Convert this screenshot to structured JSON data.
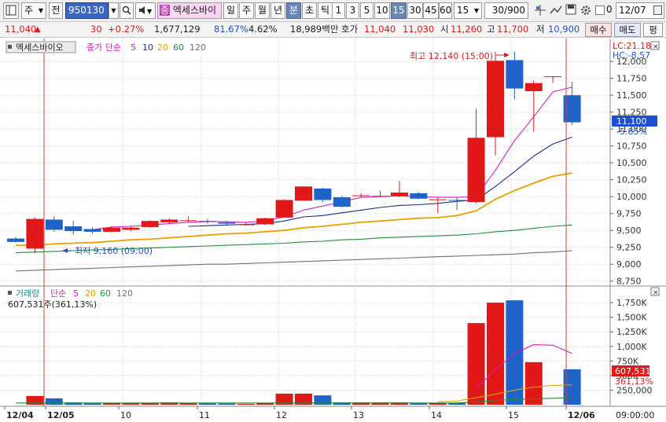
{
  "toolbar": {
    "type_label": "주",
    "all_label": "전",
    "code_value": "950130",
    "stock_tag": "종",
    "stock_name": "엑세스바이",
    "periods": [
      "일",
      "주",
      "월",
      "년",
      "분",
      "초",
      "틱"
    ],
    "selected_period": "분",
    "minutes": [
      "1",
      "3",
      "5",
      "10",
      "15",
      "30",
      "45",
      "60"
    ],
    "selected_minute": "15",
    "interval_value": "15",
    "count_value": "30/900",
    "checkbox_value": "0",
    "date_value": "12/07"
  },
  "quote": {
    "price": "11,040",
    "change": "30",
    "change_pct": "+0.27%",
    "volume": "1,677,129",
    "ratio": "81.67%",
    "ratio2": "4.62%",
    "amount": "18,989백만",
    "ask_label": "호가",
    "ask": "11,040",
    "bid": "11,030",
    "open_label": "시",
    "open": "11,260",
    "high_label": "고",
    "high": "11,700",
    "low_label": "저",
    "low": "10,900",
    "buy_label": "매수",
    "sell_label": "매도",
    "eval_label": "평"
  },
  "chart": {
    "stock_name": "엑세스바이오",
    "ma_legend": {
      "title": "종가 단순",
      "periods": [
        "5",
        "10",
        "20",
        "60",
        "120"
      ]
    },
    "lc_text": "LC:21.18",
    "hc_text": "HC:-8.57",
    "price_badge": "11,100",
    "price_change": "-5.85%",
    "high_annotation": "최고 12,140 (15:00)",
    "low_annotation": "최저 9,160 (09:00)",
    "y_ticks": [
      "12,000",
      "11,750",
      "11,500",
      "11,250",
      "11,000",
      "10,750",
      "10,500",
      "10,250",
      "10,000",
      "9,750",
      "9,500",
      "9,250",
      "9,000",
      "8,750"
    ],
    "vol_legend": {
      "title": "거래량",
      "ma_title": "단순",
      "periods": [
        "5",
        "20",
        "60",
        "120"
      ]
    },
    "vol_info": "607,531주(361,13%)",
    "vol_ticks": [
      "1,750K",
      "1,500K",
      "1,250K",
      "1,000K",
      "750K",
      "500K",
      "250,000"
    ],
    "vol_badge": "607,531",
    "vol_pct": "361,13%",
    "x_labels": [
      "12/04",
      "12/05",
      "10",
      "11",
      "12",
      "13",
      "14",
      "15",
      "12/06"
    ],
    "time_label": "09:00:00"
  },
  "colors": {
    "up": "#e01818",
    "down": "#1f62c8",
    "ma5": "#d51ccb",
    "ma10": "#17308a",
    "ma20": "#e9a000",
    "ma60": "#1f8f3a",
    "ma120": "#707070"
  },
  "chart_data": {
    "type": "candlestick",
    "price_ylim": [
      8700,
      12200
    ],
    "volume_ylim": [
      0,
      1900000
    ],
    "candles": [
      {
        "o": 9380,
        "h": 9400,
        "l": 9320,
        "c": 9330
      },
      {
        "o": 9230,
        "h": 9690,
        "l": 9160,
        "c": 9670
      },
      {
        "o": 9660,
        "h": 9710,
        "l": 9480,
        "c": 9510
      },
      {
        "o": 9560,
        "h": 9640,
        "l": 9440,
        "c": 9490
      },
      {
        "o": 9520,
        "h": 9550,
        "l": 9450,
        "c": 9480
      },
      {
        "o": 9480,
        "h": 9560,
        "l": 9470,
        "c": 9540
      },
      {
        "o": 9510,
        "h": 9570,
        "l": 9490,
        "c": 9540
      },
      {
        "o": 9550,
        "h": 9650,
        "l": 9540,
        "c": 9640
      },
      {
        "o": 9620,
        "h": 9680,
        "l": 9600,
        "c": 9660
      },
      {
        "o": 9650,
        "h": 9710,
        "l": 9620,
        "c": 9650
      },
      {
        "o": 9640,
        "h": 9670,
        "l": 9600,
        "c": 9630
      },
      {
        "o": 9620,
        "h": 9640,
        "l": 9580,
        "c": 9600
      },
      {
        "o": 9580,
        "h": 9620,
        "l": 9570,
        "c": 9590
      },
      {
        "o": 9590,
        "h": 9690,
        "l": 9580,
        "c": 9680
      },
      {
        "o": 9690,
        "h": 9960,
        "l": 9690,
        "c": 9950
      },
      {
        "o": 9940,
        "h": 10150,
        "l": 9940,
        "c": 10150
      },
      {
        "o": 10120,
        "h": 10130,
        "l": 9920,
        "c": 9950
      },
      {
        "o": 9990,
        "h": 10010,
        "l": 9840,
        "c": 9850
      },
      {
        "o": 10010,
        "h": 10050,
        "l": 9990,
        "c": 10020
      },
      {
        "o": 10000,
        "h": 10090,
        "l": 9990,
        "c": 10010
      },
      {
        "o": 10010,
        "h": 10230,
        "l": 9990,
        "c": 10060
      },
      {
        "o": 10050,
        "h": 10070,
        "l": 9960,
        "c": 9970
      },
      {
        "o": 9960,
        "h": 9990,
        "l": 9760,
        "c": 9960
      },
      {
        "o": 9950,
        "h": 9990,
        "l": 9800,
        "c": 9940
      },
      {
        "o": 9920,
        "h": 11300,
        "l": 9900,
        "c": 10870
      },
      {
        "o": 10880,
        "h": 12140,
        "l": 10610,
        "c": 12010
      },
      {
        "o": 12020,
        "h": 12140,
        "l": 11440,
        "c": 11600
      },
      {
        "o": 11560,
        "h": 11720,
        "l": 10960,
        "c": 11680
      },
      {
        "o": 11780,
        "h": 11780,
        "l": 11680,
        "c": 11780
      },
      {
        "o": 11500,
        "h": 11700,
        "l": 11060,
        "c": 11100
      }
    ],
    "volume": [
      0,
      150000,
      110000,
      40000,
      30000,
      30000,
      25000,
      30000,
      40000,
      30000,
      30000,
      20000,
      15000,
      30000,
      190000,
      190000,
      160000,
      40000,
      40000,
      40000,
      40000,
      30000,
      30000,
      30000,
      1400000,
      1750000,
      1790000,
      730000,
      0,
      607531
    ],
    "ma5": [
      null,
      null,
      null,
      null,
      9510,
      9550,
      9560,
      9580,
      9600,
      9620,
      9630,
      9630,
      9620,
      9640,
      9700,
      9800,
      9860,
      9920,
      9990,
      10000,
      10010,
      10000,
      9990,
      9990,
      10000,
      10390,
      10830,
      11180,
      11550,
      11620
    ],
    "ma10": [
      null,
      null,
      null,
      null,
      null,
      null,
      null,
      null,
      null,
      9560,
      9570,
      9580,
      9590,
      9600,
      9640,
      9700,
      9720,
      9760,
      9800,
      9840,
      9870,
      9880,
      9900,
      9930,
      9950,
      10150,
      10370,
      10600,
      10780,
      10880
    ],
    "ma20": [
      9280,
      9280,
      9300,
      9310,
      9320,
      9340,
      9360,
      9370,
      9390,
      9410,
      9430,
      9450,
      9460,
      9480,
      9500,
      9540,
      9560,
      9590,
      9620,
      9640,
      9660,
      9680,
      9690,
      9720,
      9790,
      9960,
      10090,
      10200,
      10300,
      10350
    ],
    "ma60": [
      9170,
      9180,
      9190,
      9200,
      9210,
      9220,
      9230,
      9240,
      9250,
      9260,
      9270,
      9280,
      9290,
      9300,
      9310,
      9330,
      9340,
      9360,
      9370,
      9390,
      9400,
      9410,
      9420,
      9430,
      9450,
      9480,
      9500,
      9530,
      9560,
      9580
    ],
    "ma120": [
      8900,
      8910,
      8920,
      8930,
      8940,
      8950,
      8960,
      8970,
      8980,
      8990,
      9000,
      9000,
      9010,
      9020,
      9030,
      9040,
      9050,
      9060,
      9070,
      9080,
      9090,
      9100,
      9110,
      9120,
      9130,
      9140,
      9150,
      9170,
      9180,
      9200
    ],
    "vol_ma5": [
      null,
      null,
      null,
      null,
      null,
      null,
      null,
      null,
      null,
      null,
      null,
      null,
      null,
      null,
      null,
      null,
      null,
      null,
      null,
      null,
      null,
      null,
      null,
      null,
      280000,
      600000,
      880000,
      1030000,
      1020000,
      880000
    ],
    "vol_ma20": [
      null,
      null,
      null,
      null,
      null,
      null,
      null,
      null,
      null,
      null,
      null,
      null,
      null,
      null,
      null,
      null,
      null,
      null,
      null,
      null,
      null,
      null,
      50000,
      60000,
      120000,
      180000,
      250000,
      300000,
      330000,
      340000
    ],
    "vol_ma60": [
      30000,
      30000,
      30000,
      30000,
      30000,
      30000,
      30000,
      30000,
      30000,
      30000,
      30000,
      30000,
      30000,
      30000,
      30000,
      30000,
      30000,
      30000,
      30000,
      30000,
      30000,
      30000,
      30000,
      30000,
      50000,
      70000,
      90000,
      100000,
      110000,
      120000
    ]
  }
}
